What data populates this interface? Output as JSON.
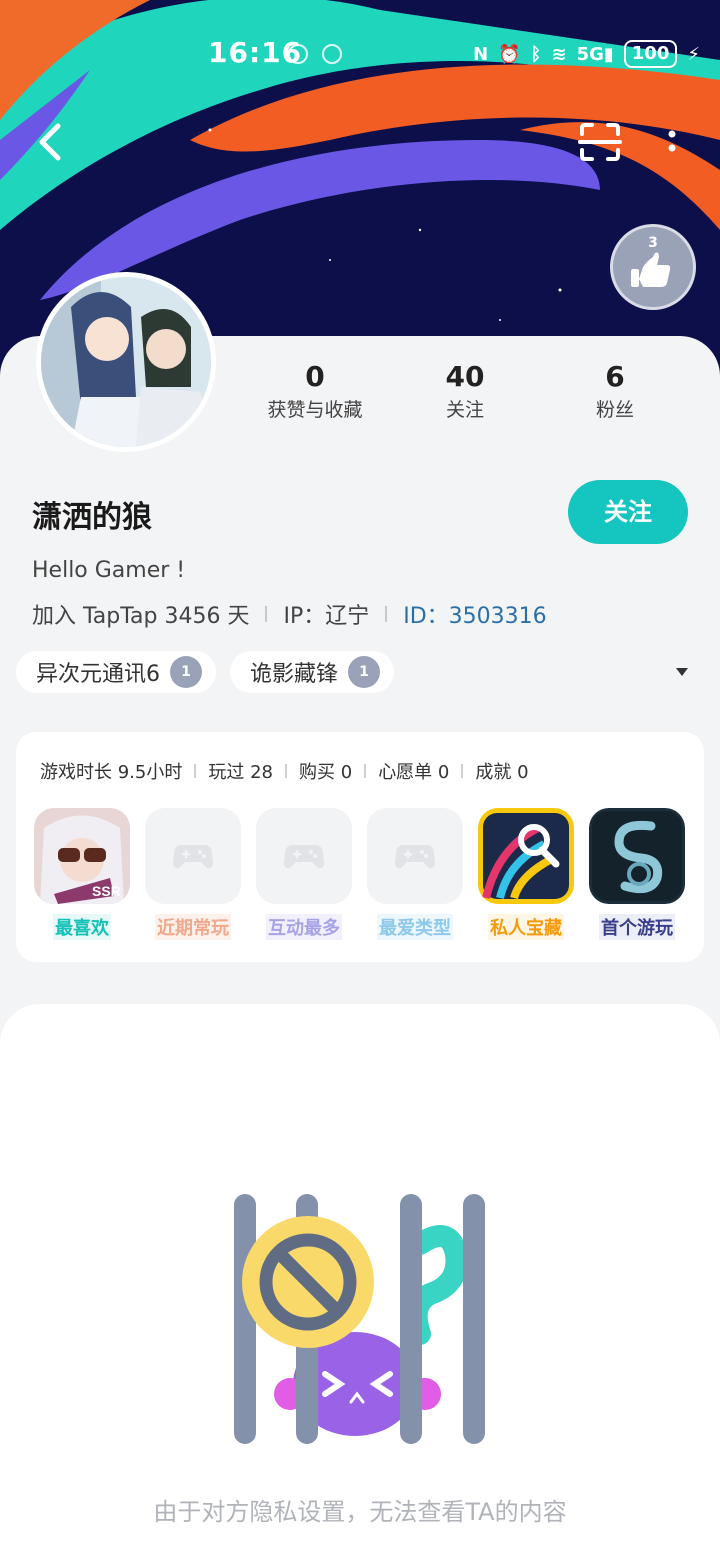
{
  "status_bar": {
    "time": "16:16",
    "battery": "100"
  },
  "profile": {
    "username": "潇洒的狼",
    "bio": "Hello Gamer !",
    "join_text": "加入 TapTap 3456 天",
    "ip_text": "IP：辽宁",
    "id_label": "ID：",
    "id_value": "3503316",
    "follow_label": "关注",
    "badge_level": "3"
  },
  "stats": [
    {
      "value": "0",
      "label": "获赞与收藏"
    },
    {
      "value": "40",
      "label": "关注"
    },
    {
      "value": "6",
      "label": "粉丝"
    }
  ],
  "tags": [
    {
      "label": "异次元通讯6",
      "badge": "1"
    },
    {
      "label": "诡影藏锋",
      "badge": "1"
    }
  ],
  "game_stats": [
    "游戏时长 9.5小时",
    "玩过 28",
    "购买 0",
    "心愿单 0",
    "成就 0"
  ],
  "games": [
    {
      "label": "最喜欢",
      "color": "#14c2b8",
      "bg": "#e7f8f6"
    },
    {
      "label": "近期常玩",
      "color": "#f0a98c",
      "bg": "#fdf1ec"
    },
    {
      "label": "互动最多",
      "color": "#a8a3e6",
      "bg": "#f1f0fb"
    },
    {
      "label": "最爱类型",
      "color": "#8fc9ea",
      "bg": "#eef7fc"
    },
    {
      "label": "私人宝藏",
      "color": "#f59a0a",
      "bg": "#fef5e4"
    },
    {
      "label": "首个游玩",
      "color": "#3a3f8c",
      "bg": "#eceef7"
    }
  ],
  "privacy_message": "由于对方隐私设置，无法查看TA的内容",
  "icons": {
    "back": "chevron-left-icon",
    "scan": "scan-icon",
    "more": "more-vertical-icon",
    "gamepad": "gamepad-icon"
  }
}
